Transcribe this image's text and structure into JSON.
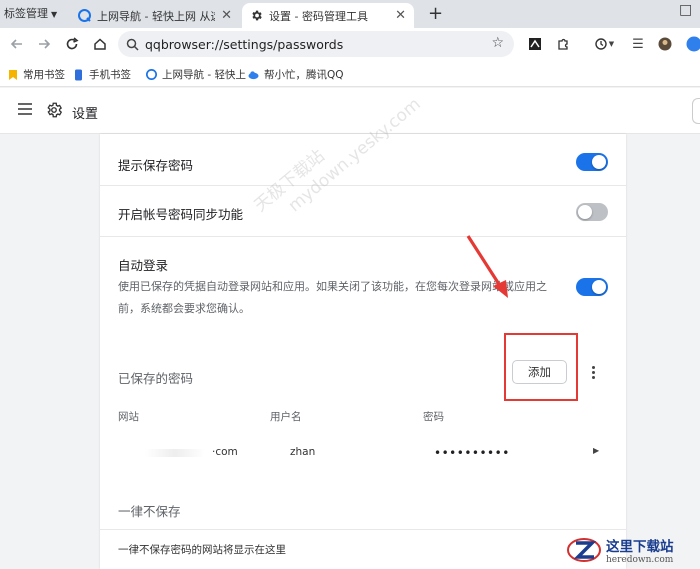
{
  "tabstrip": {
    "menu_label": "标签管理",
    "tabs": [
      {
        "title": "上网导航 - 轻快上网 从这里开始",
        "active": false
      },
      {
        "title": "设置 - 密码管理工具",
        "active": true
      }
    ],
    "new_tab": "+",
    "close": "✕",
    "minimize": "□"
  },
  "toolbar": {
    "url": "qqbrowser://settings/passwords"
  },
  "bookmarks": [
    {
      "label": "常用书签"
    },
    {
      "label": "手机书签"
    },
    {
      "label": "上网导航 - 轻快上"
    },
    {
      "label": "帮小忙，腾讯QQ"
    }
  ],
  "header": {
    "title": "设置"
  },
  "settings": {
    "offer_to_save": {
      "label": "提示保存密码",
      "enabled": true
    },
    "sync_passwords": {
      "label": "开启帐号密码同步功能",
      "enabled": false
    },
    "auto_signin": {
      "label": "自动登录",
      "description": "使用已保存的凭据自动登录网站和应用。如果关闭了该功能，在您每次登录网站或应用之前，系统都会要求您确认。",
      "enabled": true
    },
    "saved_passwords": {
      "title": "已保存的密码",
      "add_label": "添加",
      "columns": [
        "网站",
        "用户名",
        "密码"
      ],
      "rows": [
        {
          "site": "·com",
          "username": "zhan",
          "password": "••••••••••"
        }
      ]
    },
    "never_saved": {
      "title": "一律不保存",
      "empty_text": "一律不保存密码的网站将显示在这里"
    }
  },
  "overlay": {
    "watermark_line1": "天极下载站",
    "watermark_line2": "mydown.yesky.com",
    "logo_name": "这里下载站",
    "logo_url": "heredown.com"
  },
  "colors": {
    "accent": "#1a73e8",
    "toggle_off": "#bdc1c6",
    "annotation_red": "#e53935"
  }
}
